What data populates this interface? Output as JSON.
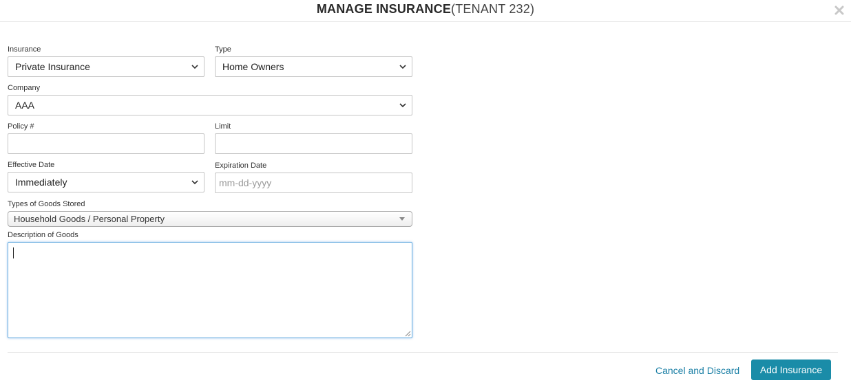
{
  "header": {
    "title_main": "MANAGE INSURANCE",
    "title_sub": "(TENANT 232)",
    "close_icon": "close-icon"
  },
  "form": {
    "insurance": {
      "label": "Insurance",
      "value": "Private Insurance"
    },
    "type": {
      "label": "Type",
      "value": "Home Owners"
    },
    "company": {
      "label": "Company",
      "value": "AAA"
    },
    "policy": {
      "label": "Policy #",
      "value": ""
    },
    "limit": {
      "label": "Limit",
      "value": ""
    },
    "effective_date": {
      "label": "Effective Date",
      "value": "Immediately"
    },
    "expiration_date": {
      "label": "Expiration Date",
      "value": "",
      "placeholder": "mm-dd-yyyy"
    },
    "goods_types": {
      "label": "Types of Goods Stored",
      "value": "Household Goods / Personal Property"
    },
    "description": {
      "label": "Description of Goods",
      "value": ""
    }
  },
  "footer": {
    "cancel_label": "Cancel and Discard",
    "submit_label": "Add Insurance"
  },
  "colors": {
    "accent": "#1a8ca8",
    "link": "#1a7fa5",
    "focus_border": "#6aaee0"
  }
}
